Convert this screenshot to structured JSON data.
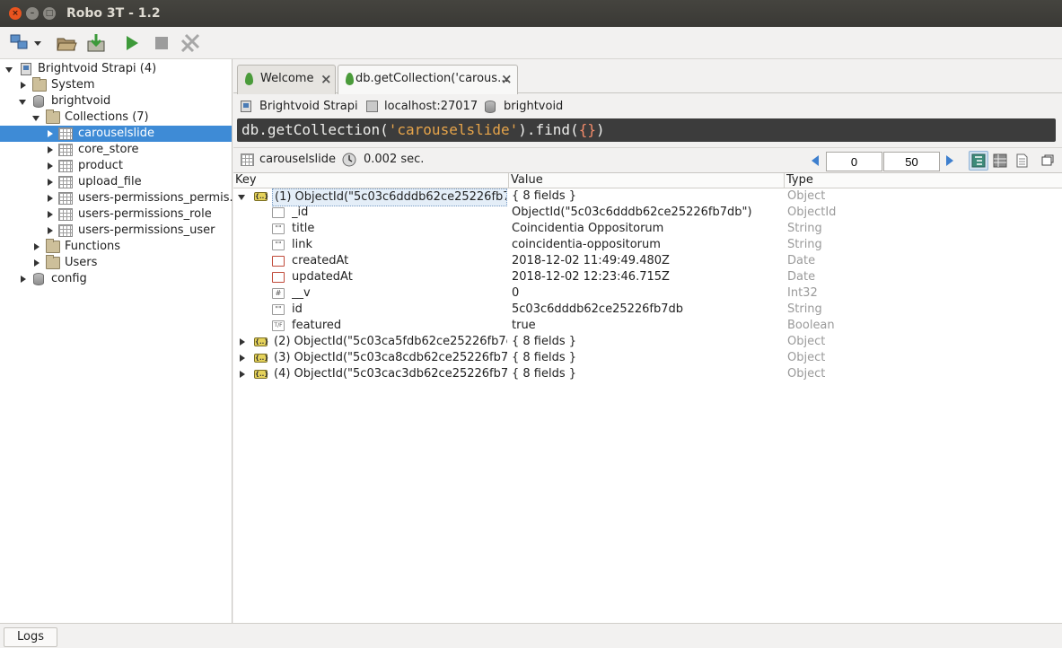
{
  "window": {
    "title": "Robo 3T - 1.2"
  },
  "toolbar": {
    "buttons": [
      "connect-icon",
      "open-icon",
      "save-icon",
      "execute-icon",
      "stop-icon",
      "explain-icon"
    ]
  },
  "tree": {
    "server": "Brightvoid Strapi (4)",
    "system": "System",
    "db": "brightvoid",
    "collections": "Collections (7)",
    "items": [
      "carouselslide",
      "core_store",
      "product",
      "upload_file",
      "users-permissions_permis...",
      "users-permissions_role",
      "users-permissions_user"
    ],
    "functions": "Functions",
    "users": "Users",
    "config": "config"
  },
  "tabs": [
    {
      "label": "Welcome"
    },
    {
      "label": "db.getCollection('carous..."
    }
  ],
  "info": {
    "connection": "Brightvoid Strapi",
    "host": "localhost:27017",
    "database": "brightvoid"
  },
  "query": {
    "prefix": "db.getCollection(",
    "arg": "'carouselslide'",
    "mid": ").find(",
    "braces": "{}",
    "suffix": ")"
  },
  "result": {
    "collection": "carouselslide",
    "time": "0.002 sec.",
    "skip": "0",
    "limit": "50"
  },
  "grid": {
    "headers": {
      "key": "Key",
      "value": "Value",
      "type": "Type"
    },
    "rows": [
      {
        "key": "(1) ObjectId(\"5c03c6dddb62ce25226fb7...",
        "value": "{ 8 fields }",
        "type": "Object"
      },
      {
        "key": "_id",
        "value": "ObjectId(\"5c03c6dddb62ce25226fb7db\")",
        "type": "ObjectId"
      },
      {
        "key": "title",
        "value": "Coincidentia Oppositorum",
        "type": "String"
      },
      {
        "key": "link",
        "value": "coincidentia-oppositorum",
        "type": "String"
      },
      {
        "key": "createdAt",
        "value": "2018-12-02 11:49:49.480Z",
        "type": "Date"
      },
      {
        "key": "updatedAt",
        "value": "2018-12-02 12:23:46.715Z",
        "type": "Date"
      },
      {
        "key": "__v",
        "value": "0",
        "type": "Int32"
      },
      {
        "key": "id",
        "value": "5c03c6dddb62ce25226fb7db",
        "type": "String"
      },
      {
        "key": "featured",
        "value": "true",
        "type": "Boolean"
      },
      {
        "key": "(2) ObjectId(\"5c03ca5fdb62ce25226fb7e...",
        "value": "{ 8 fields }",
        "type": "Object"
      },
      {
        "key": "(3) ObjectId(\"5c03ca8cdb62ce25226fb7...",
        "value": "{ 8 fields }",
        "type": "Object"
      },
      {
        "key": "(4) ObjectId(\"5c03cac3db62ce25226fb7...",
        "value": "{ 8 fields }",
        "type": "Object"
      }
    ],
    "icon_text": {
      "string": "\"\"",
      "int": "#",
      "bool": "T/F",
      "obj": "{..}"
    }
  },
  "statusbar": {
    "logs": "Logs"
  },
  "colors": {
    "selection": "#3e8bd6",
    "title_bg": "#3c3b37",
    "query_bg": "#3c3c3c",
    "string": "#e6a44a",
    "brace": "#f28b6a"
  }
}
